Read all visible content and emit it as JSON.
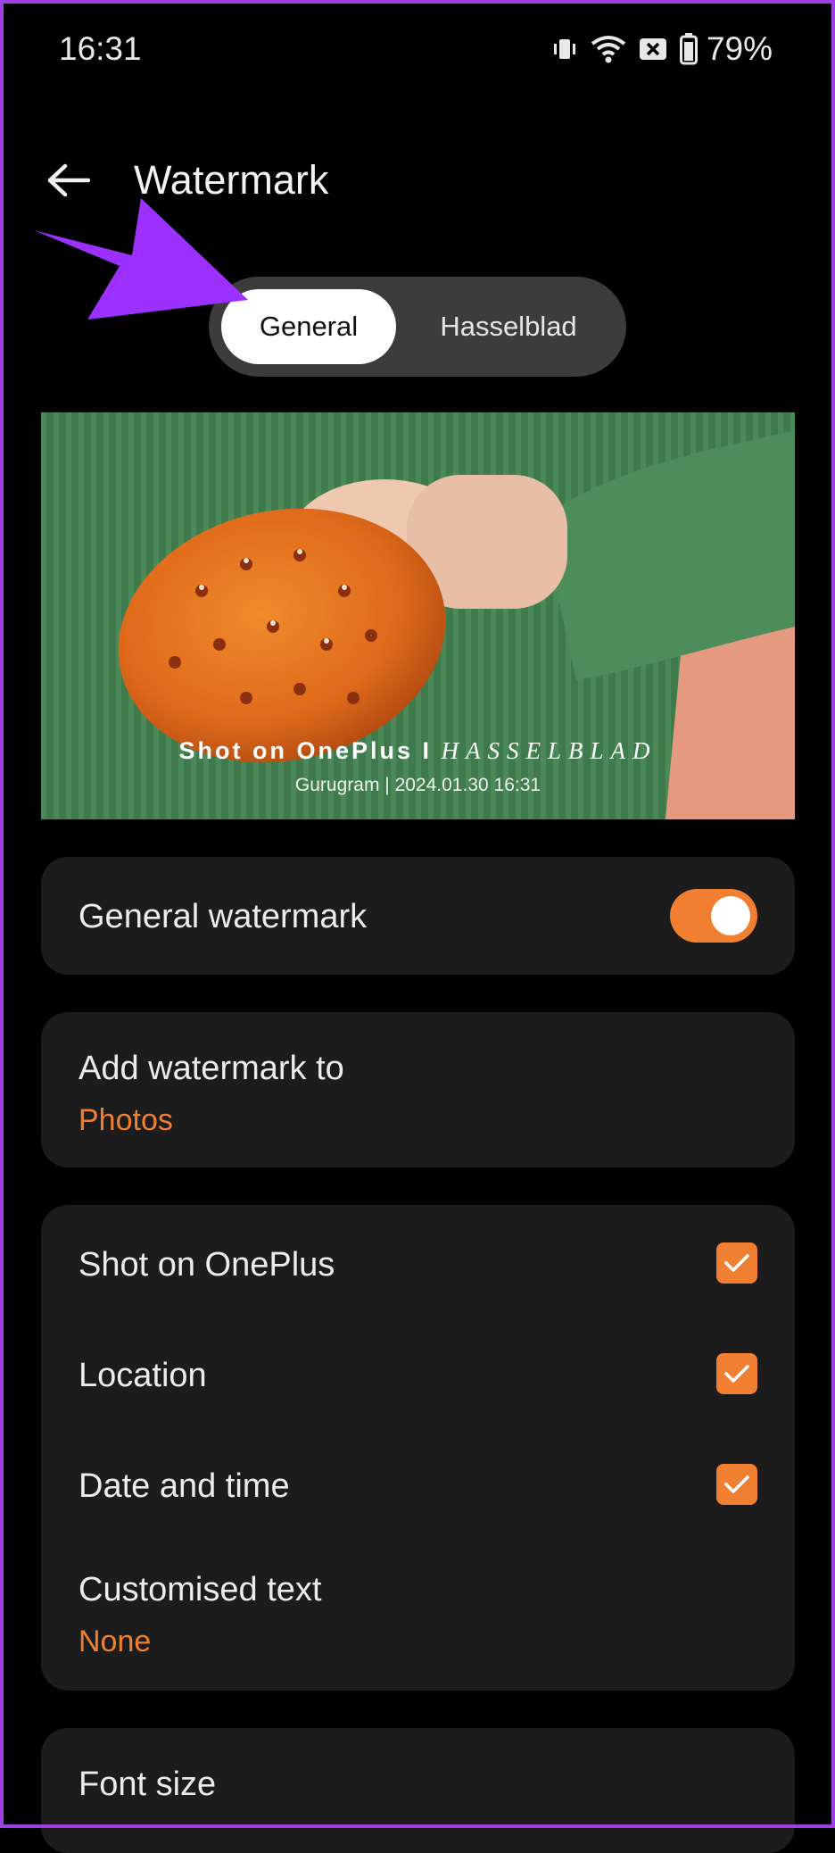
{
  "status_bar": {
    "time": "16:31",
    "battery": "79%"
  },
  "header": {
    "title": "Watermark"
  },
  "tabs": [
    {
      "label": "General"
    },
    {
      "label": "Hasselblad"
    }
  ],
  "preview": {
    "line1_prefix": "Shot on OnePlus I ",
    "line1_brand": "HASSELBLAD",
    "line2": "Gurugram  |  2024.01.30 16:31"
  },
  "general_watermark": {
    "label": "General watermark",
    "enabled": true
  },
  "add_watermark": {
    "label": "Add watermark to",
    "value": "Photos"
  },
  "options": [
    {
      "label": "Shot on OnePlus",
      "checked": true
    },
    {
      "label": "Location",
      "checked": true
    },
    {
      "label": "Date and time",
      "checked": true
    }
  ],
  "custom_text": {
    "label": "Customised text",
    "value": "None"
  },
  "font_size": {
    "label": "Font size"
  },
  "colors": {
    "accent": "#f07f32",
    "card": "#1c1c1c",
    "frame": "#9b3fe0",
    "arrow": "#9b30ff"
  }
}
